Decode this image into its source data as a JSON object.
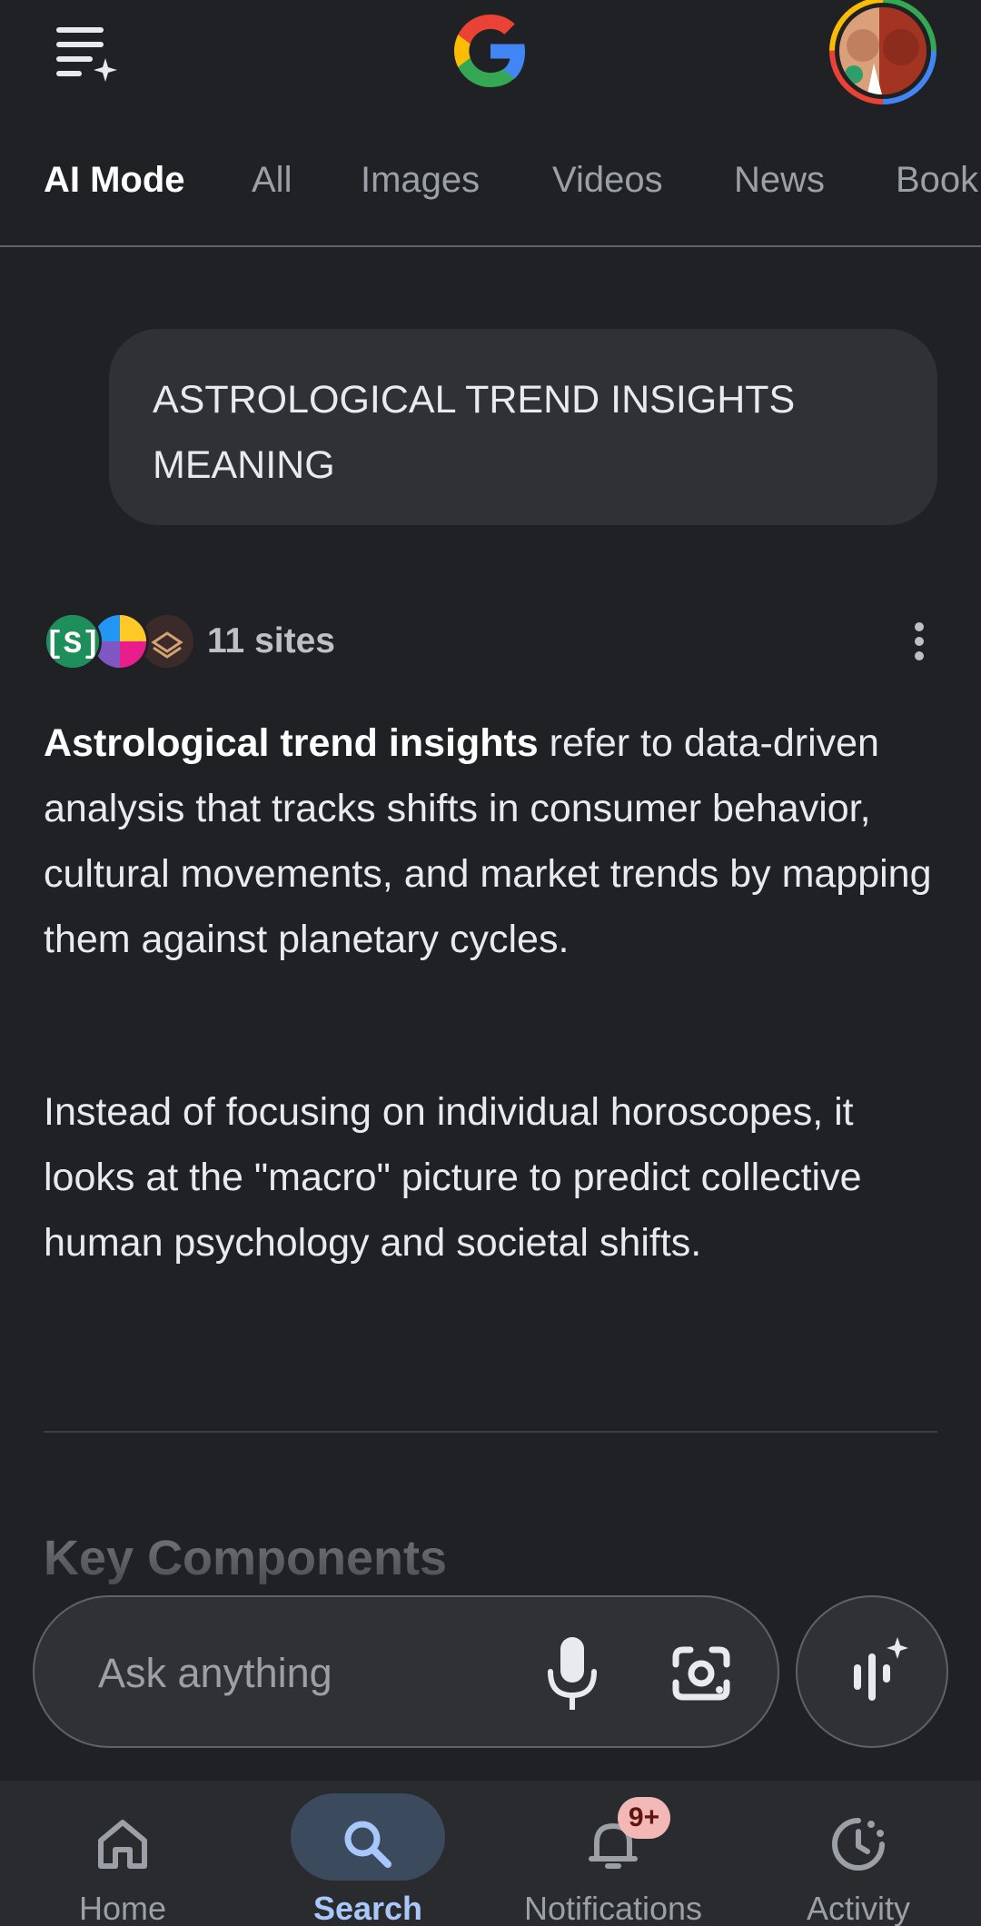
{
  "header": {
    "menu_icon": "menu-sparkle-icon",
    "logo": "google-g-logo",
    "avatar": "profile-avatar"
  },
  "tabs": [
    {
      "label": "AI Mode",
      "active": true
    },
    {
      "label": "All"
    },
    {
      "label": "Images"
    },
    {
      "label": "Videos"
    },
    {
      "label": "News"
    },
    {
      "label": "Book"
    }
  ],
  "query": {
    "text": "ASTROLOGICAL TREND INSIGHTS\nMEANING"
  },
  "sources": {
    "count_label": "11 sites",
    "favicons": [
      "s-bracket-favicon",
      "colorful-favicon",
      "bubbles-favicon"
    ],
    "more_icon": "more-vert-icon"
  },
  "answer": {
    "p1_bold": "Astrological trend insights",
    "p1_rest": " refer to data-driven analysis that tracks shifts in consumer behavior, cultural movements, and market trends by mapping them against planetary cycles.",
    "p2": "Instead of focusing on individual horoscopes, it looks at the \"macro\" picture to predict collective human psychology and societal shifts.",
    "next_heading": "Key Components"
  },
  "ask_bar": {
    "placeholder": "Ask anything",
    "mic_icon": "mic-icon",
    "lens_icon": "lens-camera-icon",
    "live_icon": "live-voice-icon"
  },
  "bottom_nav": {
    "items": [
      {
        "label": "Home",
        "icon": "home-icon"
      },
      {
        "label": "Search",
        "icon": "search-icon",
        "active": true
      },
      {
        "label": "Notifications",
        "icon": "bell-icon",
        "badge": "9+"
      },
      {
        "label": "Activity",
        "icon": "activity-icon"
      }
    ]
  },
  "colors": {
    "background": "#202124",
    "surface": "#303134",
    "text": "#e8eaed",
    "muted": "#9aa0a6",
    "accent": "#a8c7fa",
    "badge": "#f2b8b5"
  }
}
